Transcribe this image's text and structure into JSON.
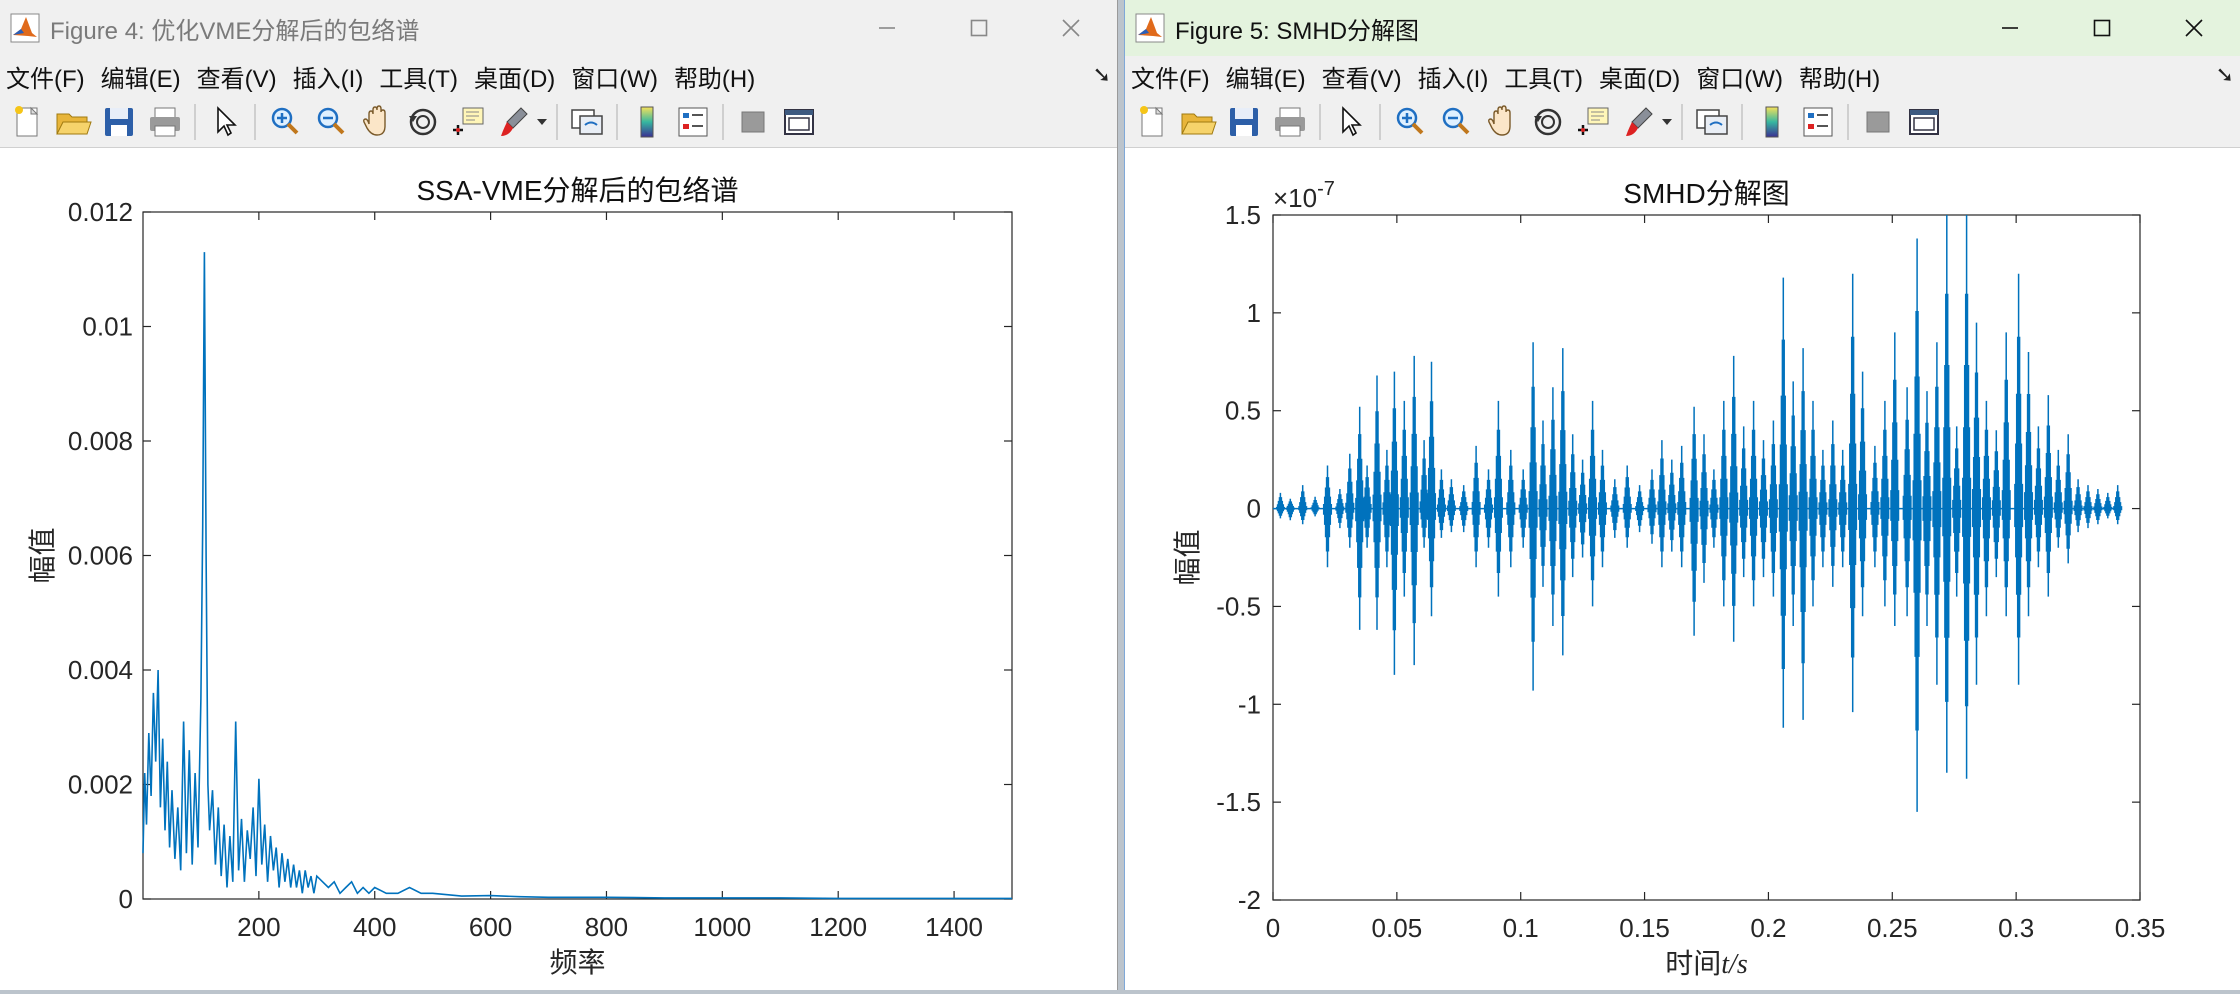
{
  "windows": [
    {
      "title": "Figure 4: 优化VME分解后的包络谱",
      "menu": [
        "文件(F)",
        "编辑(E)",
        "查看(V)",
        "插入(I)",
        "工具(T)",
        "桌面(D)",
        "窗口(W)",
        "帮助(H)"
      ],
      "chart_data": {
        "type": "line",
        "title": "SSA-VME分解后的包络谱",
        "xlabel": "频率",
        "ylabel": "幅值",
        "xlim": [
          0,
          1500
        ],
        "ylim": [
          0,
          0.012
        ],
        "xticks": [
          "200",
          "400",
          "600",
          "800",
          "1000",
          "1200",
          "1400"
        ],
        "yticks": [
          "0",
          "0.002",
          "0.004",
          "0.006",
          "0.008",
          "0.01",
          "0.012"
        ],
        "grid": false,
        "series": [
          {
            "color": "#0072BD",
            "x": [
              0,
              3,
              6,
              10,
              14,
              18,
              22,
              26,
              30,
              34,
              38,
              42,
              46,
              50,
              55,
              60,
              65,
              70,
              75,
              80,
              85,
              90,
              95,
              100,
              103,
              106,
              109,
              112,
              115,
              120,
              125,
              130,
              135,
              140,
              145,
              150,
              155,
              160,
              165,
              170,
              175,
              180,
              185,
              190,
              195,
              200,
              205,
              210,
              215,
              220,
              225,
              230,
              235,
              240,
              245,
              250,
              255,
              260,
              265,
              270,
              275,
              280,
              285,
              290,
              295,
              300,
              310,
              320,
              330,
              340,
              350,
              360,
              370,
              380,
              390,
              400,
              420,
              440,
              460,
              480,
              500,
              550,
              600,
              650,
              700,
              800,
              900,
              1000,
              1100,
              1200,
              1300,
              1400,
              1500
            ],
            "y": [
              0.0008,
              0.0022,
              0.0013,
              0.0029,
              0.0018,
              0.0036,
              0.0024,
              0.004,
              0.0016,
              0.0028,
              0.0012,
              0.0024,
              0.0009,
              0.0019,
              0.0007,
              0.0016,
              0.0005,
              0.0031,
              0.0008,
              0.0026,
              0.0006,
              0.0022,
              0.0009,
              0.0035,
              0.0065,
              0.0113,
              0.006,
              0.002,
              0.0012,
              0.0019,
              0.0006,
              0.0016,
              0.0004,
              0.0013,
              0.0002,
              0.0011,
              0.0003,
              0.0031,
              0.0005,
              0.0014,
              0.0003,
              0.0012,
              0.0007,
              0.0016,
              0.0004,
              0.0021,
              0.0006,
              0.0013,
              0.0003,
              0.0011,
              0.0005,
              0.0009,
              0.0002,
              0.0008,
              0.0003,
              0.0007,
              0.0002,
              0.0006,
              0.0002,
              0.0005,
              0.0001,
              0.0005,
              0.0002,
              0.0004,
              0.0001,
              0.0004,
              0.0003,
              0.0002,
              0.0003,
              0.0001,
              0.0002,
              0.0003,
              0.0001,
              0.0002,
              0.0001,
              0.0002,
              0.0001,
              0.0001,
              0.0002,
              0.0001,
              0.0001,
              5e-05,
              6e-05,
              4e-05,
              3e-05,
              3e-05,
              2e-05,
              2e-05,
              2e-05,
              1e-05,
              1e-05,
              1e-05,
              1e-05
            ]
          }
        ]
      }
    },
    {
      "title": "Figure 5: SMHD分解图",
      "menu": [
        "文件(F)",
        "编辑(E)",
        "查看(V)",
        "插入(I)",
        "工具(T)",
        "桌面(D)",
        "窗口(W)",
        "帮助(H)"
      ],
      "chart_data": {
        "type": "line",
        "title": "SMHD分解图",
        "xlabel": "时间t/s",
        "ylabel": "幅值",
        "xlim": [
          0,
          0.35
        ],
        "ylim": [
          -2,
          1.5
        ],
        "exponent_label": "×10-7",
        "xticks": [
          "0",
          "0.05",
          "0.1",
          "0.15",
          "0.2",
          "0.25",
          "0.3",
          "0.35"
        ],
        "yticks": [
          "-2",
          "-1.5",
          "-1",
          "-0.5",
          "0",
          "0.5",
          "1",
          "1.5"
        ],
        "grid": false,
        "series": [
          {
            "color": "#0072BD",
            "t": [
              0.003,
              0.007,
              0.012,
              0.017,
              0.022,
              0.027,
              0.031,
              0.035,
              0.038,
              0.042,
              0.046,
              0.049,
              0.053,
              0.057,
              0.061,
              0.064,
              0.068,
              0.072,
              0.077,
              0.082,
              0.087,
              0.091,
              0.096,
              0.101,
              0.105,
              0.109,
              0.113,
              0.117,
              0.121,
              0.125,
              0.129,
              0.133,
              0.138,
              0.143,
              0.148,
              0.153,
              0.157,
              0.161,
              0.165,
              0.17,
              0.174,
              0.178,
              0.182,
              0.186,
              0.19,
              0.194,
              0.198,
              0.202,
              0.206,
              0.21,
              0.214,
              0.218,
              0.222,
              0.226,
              0.23,
              0.234,
              0.238,
              0.243,
              0.247,
              0.251,
              0.256,
              0.26,
              0.264,
              0.268,
              0.272,
              0.276,
              0.28,
              0.284,
              0.288,
              0.292,
              0.296,
              0.301,
              0.305,
              0.309,
              0.313,
              0.317,
              0.321,
              0.325,
              0.329,
              0.333,
              0.337,
              0.341
            ],
            "pos": [
              0.08,
              0.05,
              0.12,
              0.06,
              0.22,
              0.1,
              0.28,
              0.52,
              0.22,
              0.68,
              0.3,
              0.7,
              0.55,
              0.78,
              0.35,
              0.75,
              0.2,
              0.15,
              0.12,
              0.32,
              0.2,
              0.55,
              0.3,
              0.2,
              0.85,
              0.45,
              0.62,
              0.82,
              0.38,
              0.25,
              0.55,
              0.3,
              0.15,
              0.22,
              0.12,
              0.2,
              0.35,
              0.25,
              0.32,
              0.52,
              0.38,
              0.2,
              0.55,
              0.78,
              0.42,
              0.55,
              0.35,
              0.45,
              1.18,
              0.65,
              0.82,
              0.55,
              0.3,
              0.45,
              0.3,
              1.2,
              0.7,
              0.32,
              0.55,
              0.9,
              0.62,
              1.38,
              0.6,
              0.85,
              1.5,
              0.42,
              1.5,
              0.95,
              0.55,
              0.4,
              0.9,
              1.2,
              0.8,
              0.42,
              0.58,
              0.3,
              0.38,
              0.15,
              0.12,
              0.1,
              0.08,
              0.12
            ],
            "neg": [
              0.05,
              0.06,
              0.08,
              0.04,
              0.3,
              0.1,
              0.2,
              0.62,
              0.2,
              0.62,
              0.3,
              0.85,
              0.45,
              0.8,
              0.2,
              0.55,
              0.15,
              0.12,
              0.12,
              0.3,
              0.2,
              0.45,
              0.3,
              0.2,
              0.93,
              0.4,
              0.6,
              0.75,
              0.35,
              0.25,
              0.5,
              0.3,
              0.15,
              0.2,
              0.12,
              0.18,
              0.3,
              0.22,
              0.3,
              0.65,
              0.38,
              0.2,
              0.5,
              0.68,
              0.35,
              0.5,
              0.35,
              0.45,
              1.12,
              0.6,
              1.08,
              0.5,
              0.3,
              0.4,
              0.3,
              1.04,
              0.55,
              0.3,
              0.5,
              0.6,
              0.55,
              1.55,
              0.6,
              0.9,
              1.35,
              0.45,
              1.38,
              0.9,
              0.55,
              0.35,
              0.55,
              0.9,
              0.55,
              0.3,
              0.45,
              0.2,
              0.28,
              0.12,
              0.1,
              0.08,
              0.05,
              0.08
            ]
          }
        ]
      }
    }
  ]
}
